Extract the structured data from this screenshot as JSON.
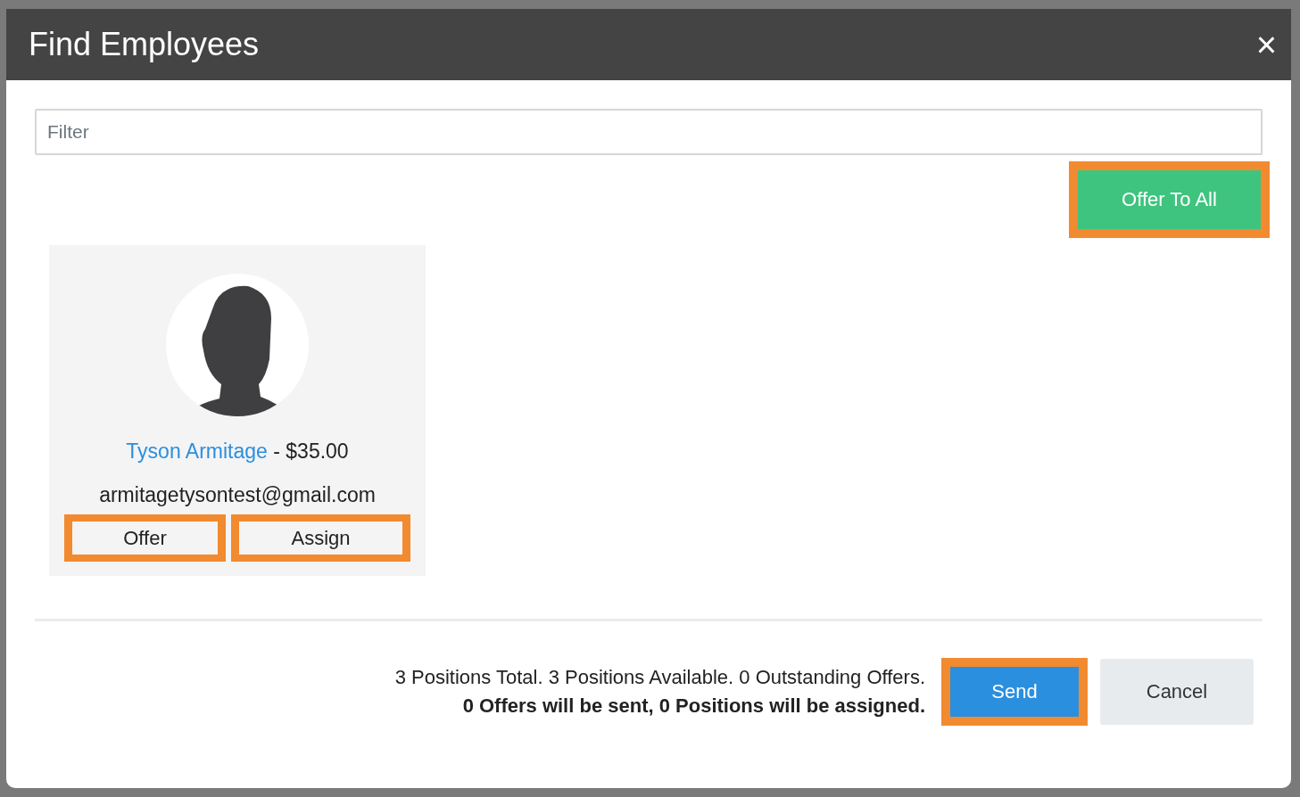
{
  "dialog": {
    "title": "Find Employees",
    "close": "×"
  },
  "filter": {
    "placeholder": "Filter"
  },
  "offer_all": {
    "label": "Offer To All",
    "highlighted": true
  },
  "employees": [
    {
      "name": "Tyson Armitage",
      "rate": " - $35.00",
      "email": "armitagetysontest@gmail.com",
      "buttons": [
        {
          "label": "Offer",
          "highlighted": true
        },
        {
          "label": "Assign",
          "highlighted": true
        }
      ]
    }
  ],
  "footer": {
    "summary": "3 Positions Total. 3 Positions Available. 0 Outstanding Offers.",
    "notice": "0 Offers will be sent, 0 Positions will be assigned.",
    "buttons": [
      {
        "label": "Send",
        "kind": "primary",
        "highlighted": true
      },
      {
        "label": "Cancel",
        "kind": "secondary",
        "highlighted": false
      }
    ]
  }
}
